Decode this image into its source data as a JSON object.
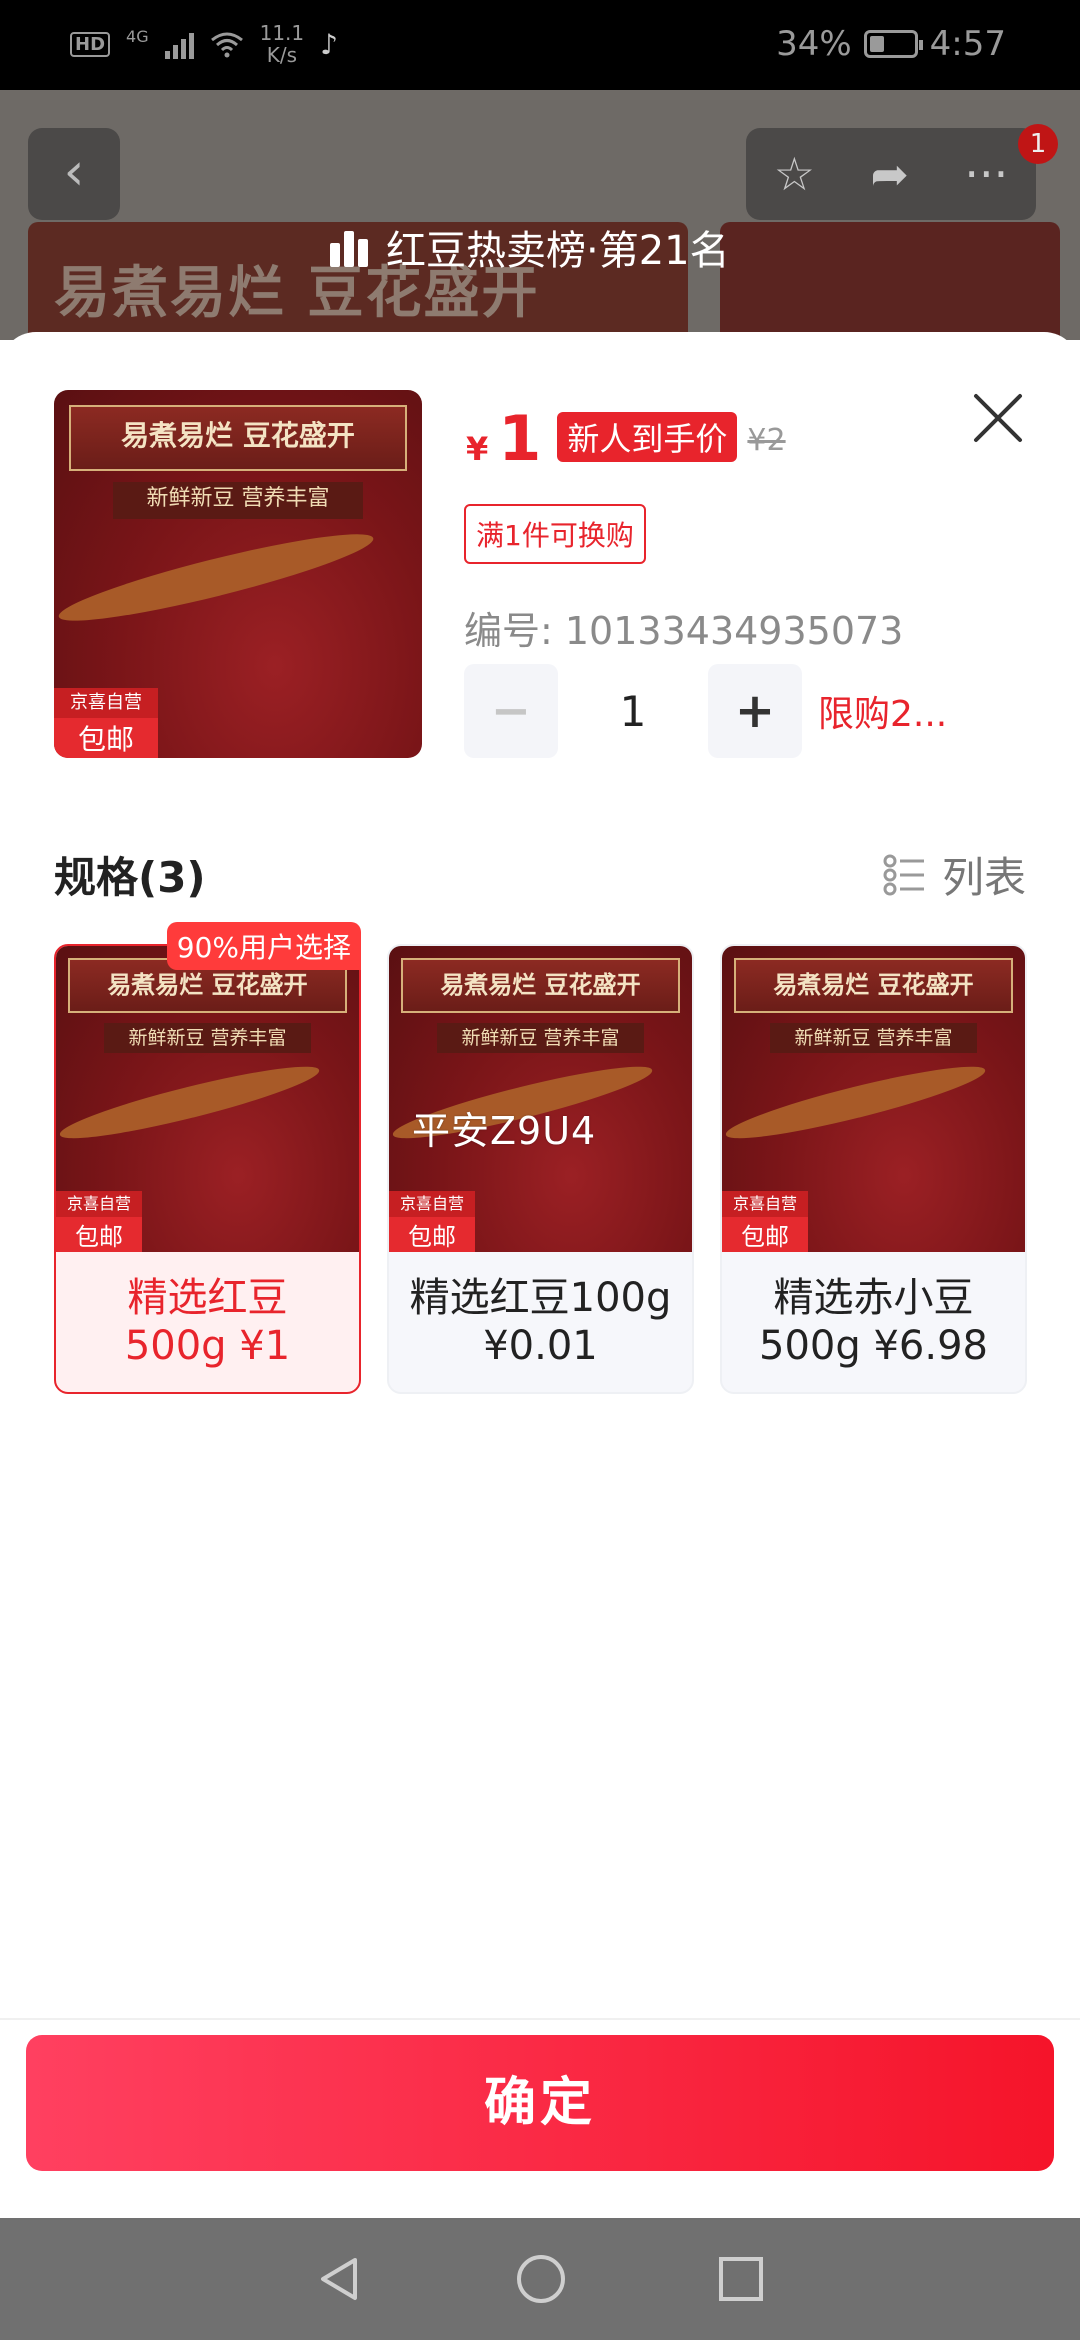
{
  "status_bar": {
    "hd": "HD",
    "network": "4G",
    "speed_value": "11.1",
    "speed_unit": "K/s",
    "battery": "34%",
    "time": "4:57"
  },
  "background_page": {
    "banner_text": "易煮易烂 豆花盛开",
    "cart_badge_count": "1",
    "rank_text": "红豆热卖榜·第21名"
  },
  "product": {
    "price_symbol": "¥",
    "price": "1",
    "price_tag": "新人到手价",
    "original_price": "¥2",
    "swap_tag": "满1件可换购",
    "sku_label": "编号: 10133434935073",
    "quantity": "1",
    "limit_text": "限购2...",
    "image_title": "易煮易烂 豆花盛开",
    "image_subtitle": "新鲜新豆 营养丰富",
    "image_badge_top": "京喜自营",
    "image_badge_bottom": "包邮"
  },
  "specs": {
    "title": "规格(3)",
    "list_toggle": "列表",
    "hot_badge": "90%用户选择",
    "watermark": "平安Z9U4",
    "options": [
      {
        "line1": "精选红豆",
        "line2": "500g ¥1",
        "selected": true
      },
      {
        "line1": "精选红豆100g",
        "line2": "¥0.01",
        "selected": false
      },
      {
        "line1": "精选赤小豆",
        "line2": "500g ¥6.98",
        "selected": false
      }
    ]
  },
  "confirm_label": "确定",
  "colors": {
    "accent": "#e8242c",
    "button_gradient_start": "#ff4060",
    "button_gradient_end": "#f5142a"
  }
}
